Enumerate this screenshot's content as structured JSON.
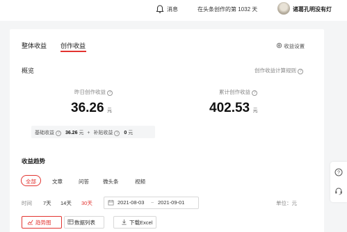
{
  "header": {
    "messages_label": "消息",
    "creation_days_text": "在头条创作的第 1032 天",
    "username": "诸葛孔明没有灯"
  },
  "tabs": {
    "overall": "整体收益",
    "creation": "创作收益",
    "active": "创作收益"
  },
  "settings_label": "收益设置",
  "overview": {
    "title": "概览",
    "rules_link": "创作收益计算规则",
    "yesterday_label": "昨日创作收益",
    "yesterday_value": "36.26",
    "yesterday_unit": "元",
    "total_label": "累计创作收益",
    "total_value": "402.53",
    "total_unit": "元",
    "base_label": "基础收益",
    "base_value": "36.26",
    "base_unit": "元",
    "plus": "+",
    "subsidy_label": "补贴收益",
    "subsidy_value": "0",
    "subsidy_unit": "元"
  },
  "trend": {
    "title": "收益趋势",
    "filters": [
      "全部",
      "文章",
      "问答",
      "微头条",
      "视频"
    ],
    "active_filter": "全部",
    "time_label": "时间",
    "ranges": [
      "7天",
      "14天",
      "30天"
    ],
    "active_range": "30天",
    "date_start": "2021-08-03",
    "date_sep": "~",
    "date_end": "2021-09-01",
    "unit_label": "单位：元",
    "views": {
      "chart_label": "趋势图",
      "list_label": "数据列表",
      "download_label": "下载Excel"
    }
  },
  "colors": {
    "accent": "#e2332f",
    "background": "#f4f5f6"
  }
}
